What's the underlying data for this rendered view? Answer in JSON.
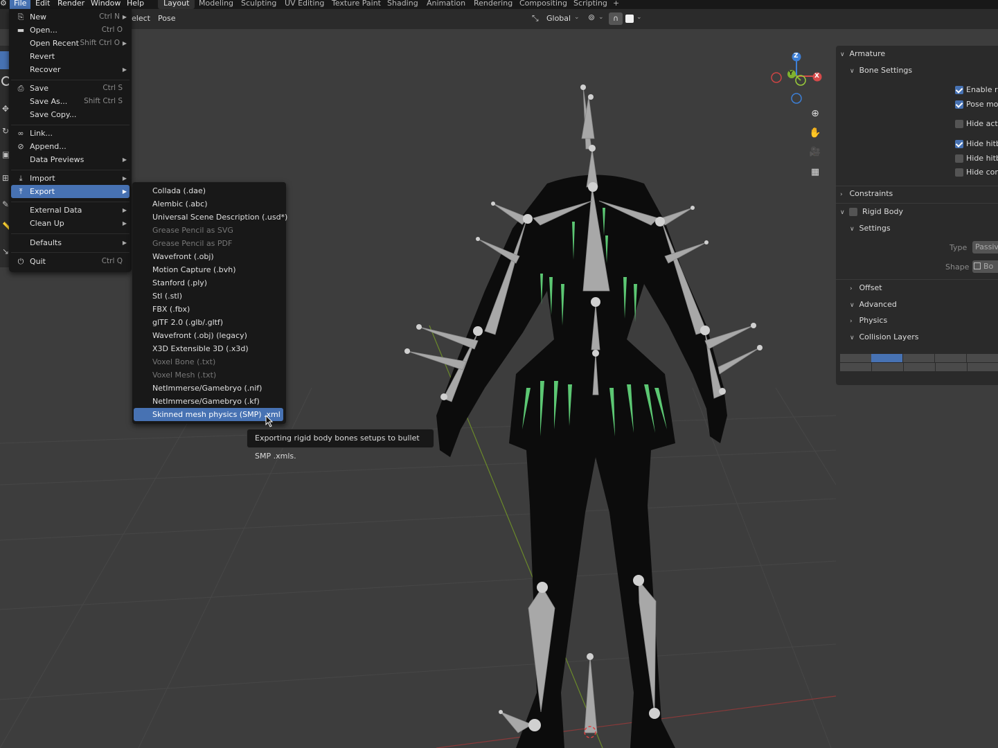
{
  "topbar": {
    "menus": [
      "File",
      "Edit",
      "Render",
      "Window",
      "Help"
    ],
    "workspaces": [
      "Layout",
      "Modeling",
      "Sculpting",
      "UV Editing",
      "Texture Paint",
      "Shading",
      "Animation",
      "Rendering",
      "Compositing",
      "Scripting"
    ],
    "add_tab": "+"
  },
  "header": {
    "select_menu": "elect",
    "pose_menu": "Pose",
    "orientation": "Global"
  },
  "file_menu": {
    "items": [
      {
        "label": "New",
        "shortcut": "Ctrl N",
        "submenu": true,
        "icon": "new-file-icon"
      },
      {
        "label": "Open...",
        "shortcut": "Ctrl O",
        "icon": "folder-icon"
      },
      {
        "label": "Open Recent",
        "shortcut": "Shift Ctrl O",
        "submenu": true
      },
      {
        "label": "Revert"
      },
      {
        "label": "Recover",
        "submenu": true
      },
      {
        "label": "Save",
        "shortcut": "Ctrl S",
        "icon": "save-icon"
      },
      {
        "label": "Save As...",
        "shortcut": "Shift Ctrl S"
      },
      {
        "label": "Save Copy..."
      },
      {
        "label": "Link...",
        "icon": "link-icon"
      },
      {
        "label": "Append...",
        "icon": "append-icon"
      },
      {
        "label": "Data Previews",
        "submenu": true
      },
      {
        "label": "Import",
        "submenu": true,
        "icon": "import-icon"
      },
      {
        "label": "Export",
        "submenu": true,
        "icon": "export-icon",
        "highlighted": true
      },
      {
        "label": "External Data",
        "submenu": true
      },
      {
        "label": "Clean Up",
        "submenu": true
      },
      {
        "label": "Defaults",
        "submenu": true
      },
      {
        "label": "Quit",
        "shortcut": "Ctrl Q",
        "icon": "power-icon"
      }
    ]
  },
  "export_menu": {
    "items": [
      {
        "label": "Collada (.dae)"
      },
      {
        "label": "Alembic (.abc)"
      },
      {
        "label": "Universal Scene Description (.usd*)"
      },
      {
        "label": "Grease Pencil as SVG",
        "disabled": true
      },
      {
        "label": "Grease Pencil as PDF",
        "disabled": true
      },
      {
        "label": "Wavefront (.obj)"
      },
      {
        "label": "Motion Capture (.bvh)"
      },
      {
        "label": "Stanford (.ply)"
      },
      {
        "label": "Stl (.stl)"
      },
      {
        "label": "FBX (.fbx)"
      },
      {
        "label": "glTF 2.0 (.glb/.gltf)"
      },
      {
        "label": "Wavefront (.obj) (legacy)"
      },
      {
        "label": "X3D Extensible 3D (.x3d)"
      },
      {
        "label": "Voxel Bone (.txt)",
        "disabled": true
      },
      {
        "label": "Voxel Mesh (.txt)",
        "disabled": true
      },
      {
        "label": "NetImmerse/Gamebryo (.nif)"
      },
      {
        "label": "NetImmerse/Gamebryo (.kf)"
      },
      {
        "label": "Skinned mesh physics (SMP) .xml",
        "highlighted": true
      }
    ]
  },
  "tooltip": "Exporting rigid body bones setups to bullet SMP .xmls.",
  "gizmo": {
    "z": "Z",
    "y": "Y",
    "x": "X"
  },
  "npanel": {
    "armature": "Armature",
    "bone_settings": "Bone Settings",
    "checkboxes": [
      {
        "label": "Enable rig",
        "checked": true
      },
      {
        "label": "Pose mod",
        "checked": true
      },
      {
        "label": "Hide activ",
        "checked": false
      },
      {
        "label": "Hide hitbo",
        "checked": true
      },
      {
        "label": "Hide hitbo",
        "checked": false
      },
      {
        "label": "Hide cons",
        "checked": false
      }
    ],
    "constraints": "Constraints",
    "rigid_body": "Rigid Body",
    "settings": "Settings",
    "type_label": "Type",
    "type_value": "Passiv",
    "shape_label": "Shape",
    "shape_value": "Bo",
    "offset": "Offset",
    "advanced": "Advanced",
    "physics": "Physics",
    "collision_layers": "Collision Layers"
  },
  "colors": {
    "accent": "#4772b3",
    "menu_bg": "#181818",
    "viewport_bg": "#3d3d3d",
    "bone": "#a8a8a8",
    "green_bone": "#5cc773"
  }
}
